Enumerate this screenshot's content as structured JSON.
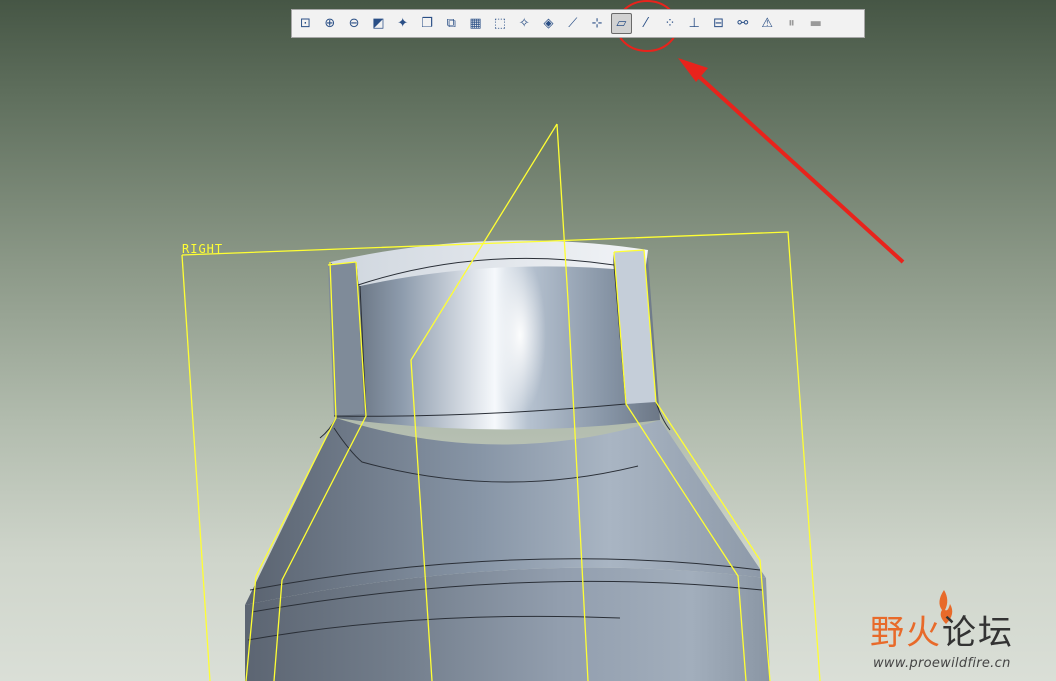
{
  "toolbar": {
    "buttons": [
      {
        "name": "refit-icon",
        "glyph": "⊡",
        "active": false
      },
      {
        "name": "zoom-in-icon",
        "glyph": "⊕",
        "active": false
      },
      {
        "name": "zoom-out-icon",
        "glyph": "⊖",
        "active": false
      },
      {
        "name": "repaint-icon",
        "glyph": "◩",
        "active": false
      },
      {
        "name": "spin-center-icon",
        "glyph": "✦",
        "active": false
      },
      {
        "name": "saved-orientations-icon",
        "glyph": "❐",
        "active": false
      },
      {
        "name": "view-manager-icon",
        "glyph": "⧉",
        "active": false
      },
      {
        "name": "appearance-icon",
        "glyph": "▦",
        "active": false
      },
      {
        "name": "perspective-icon",
        "glyph": "⬚",
        "active": false
      },
      {
        "name": "shading-icon",
        "glyph": "✧",
        "active": false
      },
      {
        "name": "display-style-icon",
        "glyph": "◈",
        "active": false
      },
      {
        "name": "plane-display-icon",
        "glyph": "⟋",
        "active": false
      },
      {
        "name": "axis-display-icon",
        "glyph": "⊹",
        "active": false
      },
      {
        "name": "plane-tag-display-icon",
        "glyph": "▱",
        "active": true
      },
      {
        "name": "axis-tag-display-icon",
        "glyph": "⁄",
        "active": false
      },
      {
        "name": "point-display-icon",
        "glyph": "⁘",
        "active": false
      },
      {
        "name": "csys-display-icon",
        "glyph": "⊥",
        "active": false
      },
      {
        "name": "annotation-display-icon",
        "glyph": "⊟",
        "active": false
      },
      {
        "name": "spin-display-icon",
        "glyph": "⚯",
        "active": false
      },
      {
        "name": "warning-display-icon",
        "glyph": "⚠",
        "active": false
      },
      {
        "name": "pause-icon",
        "glyph": "⏸",
        "active": false
      },
      {
        "name": "regenerate-icon",
        "glyph": "▬",
        "active": false
      }
    ]
  },
  "viewport": {
    "datum_plane_label": "RIGHT",
    "datum_color": "#ffff33",
    "annotation_color": "#e8231c"
  },
  "watermark": {
    "title_part1": "野火",
    "title_part2": "论坛",
    "url": "www.proewildfire.cn"
  }
}
